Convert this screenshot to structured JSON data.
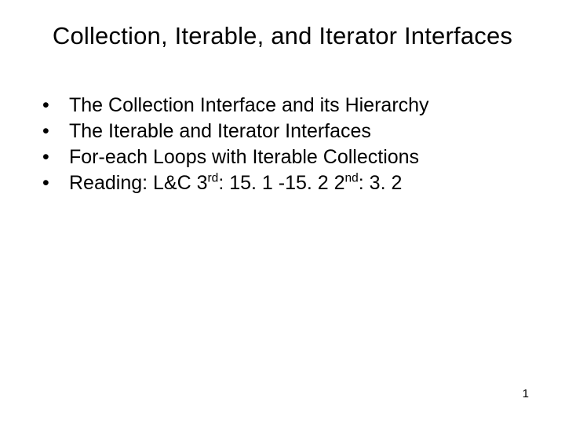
{
  "slide": {
    "title": "Collection, Iterable, and Iterator Interfaces",
    "bullets": [
      {
        "text": "The Collection Interface and its Hierarchy"
      },
      {
        "text": "The Iterable and Iterator Interfaces"
      },
      {
        "text": "For-each Loops with Iterable Collections"
      },
      {
        "text": "Reading: L&C 3rd: 15. 1 -15. 2 2nd: 3. 2",
        "segments": [
          {
            "t": "Reading: L&C 3"
          },
          {
            "t": "rd",
            "sup": true
          },
          {
            "t": ": 15. 1 -15. 2 2"
          },
          {
            "t": "nd",
            "sup": true
          },
          {
            "t": ": 3. 2"
          }
        ]
      }
    ],
    "page_number": "1"
  }
}
